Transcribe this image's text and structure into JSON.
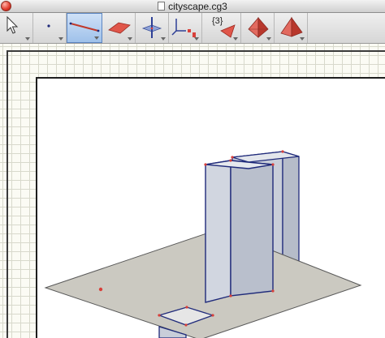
{
  "window": {
    "title": "cityscape.cg3"
  },
  "toolbar": {
    "selected_tool": "line",
    "tools": [
      {
        "name": "pointer",
        "icon": "arrow-pointer-icon"
      },
      {
        "name": "point",
        "icon": "point-icon"
      },
      {
        "name": "line",
        "icon": "line-segment-icon"
      },
      {
        "name": "plane",
        "icon": "plane-icon"
      },
      {
        "name": "intersection",
        "icon": "intersect-plane-icon"
      },
      {
        "name": "axes",
        "icon": "axes-icon"
      },
      {
        "name": "transform",
        "icon": "transform-icon",
        "label": "{3}"
      },
      {
        "name": "polyhedron",
        "icon": "polyhedron-icon"
      },
      {
        "name": "pyramid",
        "icon": "pyramid-icon"
      }
    ]
  },
  "colors": {
    "selected_tool_bg": "#a9c8ee",
    "ground_plane": "#c9c8c0",
    "building_face": "#d4d8e0",
    "edge": "#1f2a7a",
    "vertex": "#d8403a",
    "dome": "#c77fd6"
  }
}
